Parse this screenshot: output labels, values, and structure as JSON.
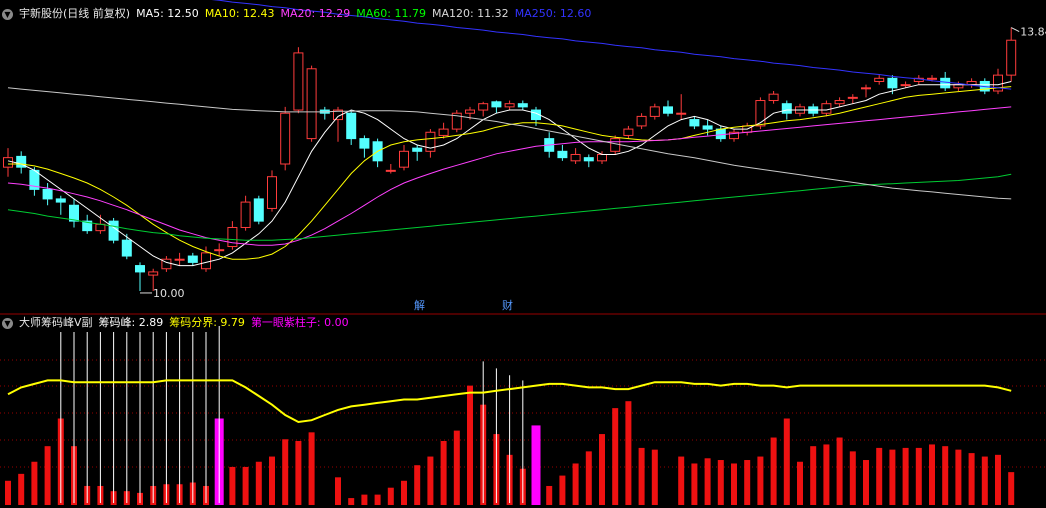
{
  "main_legend": {
    "title": "宇新股份(日线 前复权)",
    "ma5": "MA5: 12.50",
    "ma10": "MA10: 12.43",
    "ma20": "MA20: 12.29",
    "ma60": "MA60: 11.79",
    "ma120": "MA120: 11.32",
    "ma250": "MA250: 12.60"
  },
  "sub_legend": {
    "title": "大师筹码峰V副",
    "peak": "筹码峰: 2.89",
    "boundary": "筹码分界: 9.79",
    "first_purple": "第一眼紫柱子: 0.00"
  },
  "markers": {
    "jie": "解",
    "cai": "财"
  },
  "colors": {
    "background": "#000000",
    "up": "#ff3c3c",
    "down": "#54ffff",
    "ma5": "#ffffff",
    "ma10": "#ffff00",
    "ma20": "#ff40ff",
    "ma60": "#00cc33",
    "ma120": "#c8c8c8",
    "ma250": "#3333ff",
    "bar_red": "#ee1111",
    "bar_magenta": "#ff00ff",
    "bar_white": "#ffffff",
    "boundary_line": "#ffff00",
    "grid": "#990000"
  },
  "chart_data": [
    {
      "type": "candlestick",
      "title": "宇新股份(日线 前复权)",
      "y_range": [
        9.7,
        14.3
      ],
      "annotations": {
        "high": "13.84",
        "low": "10.00"
      },
      "candles": [
        [
          11.95,
          12.1,
          11.8,
          12.25
        ],
        [
          12.12,
          11.95,
          11.85,
          12.2
        ],
        [
          11.9,
          11.6,
          11.5,
          11.95
        ],
        [
          11.6,
          11.45,
          11.35,
          11.7
        ],
        [
          11.45,
          11.4,
          11.2,
          11.5
        ],
        [
          11.35,
          11.1,
          11.0,
          11.45
        ],
        [
          11.1,
          10.95,
          10.9,
          11.2
        ],
        [
          10.95,
          11.05,
          10.9,
          11.2
        ],
        [
          11.1,
          10.8,
          10.75,
          11.15
        ],
        [
          10.8,
          10.55,
          10.5,
          10.9
        ],
        [
          10.4,
          10.3,
          10.0,
          10.45
        ],
        [
          10.25,
          10.3,
          10.0,
          10.35
        ],
        [
          10.35,
          10.5,
          10.3,
          10.55
        ],
        [
          10.5,
          10.5,
          10.4,
          10.6
        ],
        [
          10.55,
          10.45,
          10.4,
          10.6
        ],
        [
          10.35,
          10.6,
          10.3,
          10.7
        ],
        [
          10.65,
          10.65,
          10.55,
          10.75
        ],
        [
          10.7,
          11.0,
          10.65,
          11.1
        ],
        [
          11.0,
          11.4,
          10.95,
          11.5
        ],
        [
          11.45,
          11.1,
          11.05,
          11.5
        ],
        [
          11.3,
          11.8,
          11.25,
          11.9
        ],
        [
          12.0,
          12.8,
          11.9,
          12.9
        ],
        [
          12.85,
          13.75,
          12.8,
          13.84
        ],
        [
          12.4,
          13.5,
          12.35,
          13.55
        ],
        [
          12.85,
          12.8,
          12.7,
          12.9
        ],
        [
          12.7,
          12.85,
          12.35,
          12.9
        ],
        [
          12.8,
          12.4,
          12.3,
          12.85
        ],
        [
          12.4,
          12.25,
          12.1,
          12.45
        ],
        [
          12.35,
          12.05,
          11.95,
          12.4
        ],
        [
          11.9,
          11.9,
          11.85,
          12.0
        ],
        [
          11.95,
          12.2,
          11.9,
          12.3
        ],
        [
          12.25,
          12.2,
          12.05,
          12.3
        ],
        [
          12.2,
          12.5,
          12.1,
          12.55
        ],
        [
          12.45,
          12.55,
          12.4,
          12.65
        ],
        [
          12.55,
          12.8,
          12.5,
          12.85
        ],
        [
          12.8,
          12.85,
          12.7,
          12.9
        ],
        [
          12.85,
          12.95,
          12.75,
          12.98
        ],
        [
          12.98,
          12.9,
          12.8,
          13.0
        ],
        [
          12.9,
          12.95,
          12.85,
          13.0
        ],
        [
          12.95,
          12.9,
          12.85,
          13.0
        ],
        [
          12.85,
          12.7,
          12.6,
          12.9
        ],
        [
          12.4,
          12.2,
          12.1,
          12.5
        ],
        [
          12.2,
          12.1,
          12.05,
          12.3
        ],
        [
          12.05,
          12.15,
          12.0,
          12.25
        ],
        [
          12.1,
          12.05,
          11.95,
          12.15
        ],
        [
          12.05,
          12.15,
          12.0,
          12.2
        ],
        [
          12.2,
          12.4,
          12.15,
          12.45
        ],
        [
          12.45,
          12.55,
          12.4,
          12.6
        ],
        [
          12.6,
          12.75,
          12.55,
          12.8
        ],
        [
          12.75,
          12.9,
          12.7,
          12.95
        ],
        [
          12.9,
          12.8,
          12.75,
          13.0
        ],
        [
          12.8,
          12.8,
          12.7,
          13.1
        ],
        [
          12.7,
          12.6,
          12.55,
          12.75
        ],
        [
          12.6,
          12.55,
          12.45,
          12.7
        ],
        [
          12.55,
          12.4,
          12.35,
          12.6
        ],
        [
          12.4,
          12.5,
          12.35,
          12.55
        ],
        [
          12.5,
          12.6,
          12.45,
          12.65
        ],
        [
          12.6,
          13.0,
          12.55,
          13.05
        ],
        [
          13.0,
          13.1,
          12.95,
          13.15
        ],
        [
          12.95,
          12.8,
          12.7,
          13.0
        ],
        [
          12.8,
          12.9,
          12.75,
          12.95
        ],
        [
          12.9,
          12.8,
          12.75,
          12.95
        ],
        [
          12.8,
          12.95,
          12.75,
          13.0
        ],
        [
          12.95,
          13.0,
          12.9,
          13.05
        ],
        [
          13.05,
          13.05,
          12.95,
          13.1
        ],
        [
          13.2,
          13.2,
          13.05,
          13.25
        ],
        [
          13.3,
          13.35,
          13.25,
          13.4
        ],
        [
          13.35,
          13.2,
          13.1,
          13.4
        ],
        [
          13.25,
          13.25,
          13.2,
          13.3
        ],
        [
          13.3,
          13.35,
          13.25,
          13.4
        ],
        [
          13.35,
          13.35,
          13.3,
          13.4
        ],
        [
          13.35,
          13.2,
          13.15,
          13.45
        ],
        [
          13.2,
          13.25,
          13.15,
          13.3
        ],
        [
          13.25,
          13.3,
          13.2,
          13.35
        ],
        [
          13.3,
          13.15,
          13.1,
          13.35
        ],
        [
          13.15,
          13.4,
          13.1,
          13.5
        ],
        [
          13.4,
          13.95,
          13.3,
          14.15
        ]
      ],
      "ma": {
        "MA5": [
          12.05,
          12.0,
          11.9,
          11.75,
          11.6,
          11.45,
          11.3,
          11.15,
          11.0,
          10.85,
          10.7,
          10.55,
          10.45,
          10.4,
          10.4,
          10.45,
          10.5,
          10.6,
          10.75,
          10.9,
          11.1,
          11.4,
          11.8,
          12.2,
          12.5,
          12.75,
          12.85,
          12.8,
          12.7,
          12.55,
          12.4,
          12.3,
          12.25,
          12.3,
          12.4,
          12.55,
          12.7,
          12.8,
          12.85,
          12.85,
          12.8,
          12.7,
          12.55,
          12.4,
          12.25,
          12.15,
          12.15,
          12.2,
          12.3,
          12.45,
          12.6,
          12.7,
          12.75,
          12.7,
          12.6,
          12.55,
          12.55,
          12.65,
          12.8,
          12.85,
          12.85,
          12.85,
          12.85,
          12.9,
          12.95,
          13.0,
          13.1,
          13.15,
          13.2,
          13.25,
          13.25,
          13.25,
          13.25,
          13.25,
          13.25,
          13.25,
          13.3
        ],
        "MA10": [
          12.0,
          12.0,
          11.97,
          11.92,
          11.85,
          11.78,
          11.7,
          11.6,
          11.48,
          11.35,
          11.2,
          11.05,
          10.92,
          10.8,
          10.7,
          10.62,
          10.55,
          10.5,
          10.5,
          10.52,
          10.58,
          10.7,
          10.88,
          11.1,
          11.35,
          11.6,
          11.85,
          12.05,
          12.2,
          12.3,
          12.35,
          12.38,
          12.4,
          12.42,
          12.45,
          12.48,
          12.52,
          12.58,
          12.62,
          12.65,
          12.65,
          12.63,
          12.6,
          12.55,
          12.5,
          12.45,
          12.42,
          12.4,
          12.38,
          12.37,
          12.38,
          12.4,
          12.45,
          12.5,
          12.55,
          12.58,
          12.6,
          12.62,
          12.65,
          12.68,
          12.7,
          12.73,
          12.76,
          12.8,
          12.85,
          12.9,
          12.95,
          13.0,
          13.05,
          13.08,
          13.1,
          13.12,
          13.14,
          13.16,
          13.18,
          13.2,
          13.22
        ],
        "MA20": [
          11.7,
          11.68,
          11.65,
          11.62,
          11.58,
          11.53,
          11.48,
          11.42,
          11.35,
          11.28,
          11.2,
          11.12,
          11.04,
          10.96,
          10.9,
          10.84,
          10.8,
          10.76,
          10.74,
          10.72,
          10.72,
          10.74,
          10.8,
          10.88,
          10.98,
          11.1,
          11.22,
          11.35,
          11.48,
          11.6,
          11.7,
          11.78,
          11.85,
          11.92,
          11.98,
          12.04,
          12.1,
          12.16,
          12.2,
          12.24,
          12.28,
          12.3,
          12.32,
          12.34,
          12.35,
          12.35,
          12.35,
          12.35,
          12.36,
          12.37,
          12.38,
          12.4,
          12.42,
          12.44,
          12.46,
          12.48,
          12.5,
          12.52,
          12.54,
          12.56,
          12.58,
          12.6,
          12.62,
          12.64,
          12.66,
          12.68,
          12.7,
          12.72,
          12.74,
          12.76,
          12.78,
          12.8,
          12.82,
          12.84,
          12.86,
          12.88,
          12.9
        ],
        "MA60": [
          11.28,
          11.25,
          11.22,
          11.18,
          11.15,
          11.12,
          11.08,
          11.05,
          11.02,
          10.98,
          10.95,
          10.92,
          10.9,
          10.87,
          10.85,
          10.83,
          10.82,
          10.81,
          10.8,
          10.8,
          10.8,
          10.81,
          10.82,
          10.84,
          10.86,
          10.88,
          10.9,
          10.92,
          10.94,
          10.96,
          10.98,
          11.0,
          11.02,
          11.04,
          11.06,
          11.08,
          11.1,
          11.12,
          11.14,
          11.16,
          11.18,
          11.2,
          11.22,
          11.24,
          11.26,
          11.28,
          11.3,
          11.32,
          11.34,
          11.36,
          11.38,
          11.4,
          11.42,
          11.44,
          11.46,
          11.48,
          11.5,
          11.52,
          11.54,
          11.56,
          11.58,
          11.6,
          11.62,
          11.64,
          11.66,
          11.67,
          11.68,
          11.69,
          11.7,
          11.71,
          11.72,
          11.73,
          11.74,
          11.76,
          11.78,
          11.8,
          11.84
        ],
        "MA120": [
          13.2,
          13.18,
          13.16,
          13.14,
          13.12,
          13.1,
          13.08,
          13.06,
          13.04,
          13.02,
          13.0,
          12.98,
          12.96,
          12.94,
          12.92,
          12.9,
          12.88,
          12.86,
          12.85,
          12.84,
          12.83,
          12.82,
          12.82,
          12.82,
          12.82,
          12.83,
          12.83,
          12.84,
          12.84,
          12.84,
          12.83,
          12.82,
          12.8,
          12.78,
          12.76,
          12.73,
          12.7,
          12.67,
          12.63,
          12.6,
          12.56,
          12.52,
          12.48,
          12.44,
          12.4,
          12.36,
          12.32,
          12.28,
          12.24,
          12.2,
          12.16,
          12.13,
          12.1,
          12.06,
          12.02,
          11.98,
          11.95,
          11.92,
          11.89,
          11.86,
          11.83,
          11.8,
          11.77,
          11.74,
          11.71,
          11.68,
          11.65,
          11.62,
          11.6,
          11.58,
          11.56,
          11.54,
          11.52,
          11.5,
          11.48,
          11.46,
          11.45
        ],
        "MA250": [
          14.95,
          14.93,
          14.9,
          14.88,
          14.86,
          14.83,
          14.81,
          14.79,
          14.76,
          14.74,
          14.72,
          14.69,
          14.67,
          14.65,
          14.62,
          14.6,
          14.58,
          14.55,
          14.53,
          14.51,
          14.48,
          14.46,
          14.43,
          14.41,
          14.39,
          14.36,
          14.34,
          14.32,
          14.29,
          14.27,
          14.25,
          14.22,
          14.2,
          14.18,
          14.15,
          14.13,
          14.11,
          14.08,
          14.06,
          14.04,
          14.01,
          13.99,
          13.97,
          13.94,
          13.92,
          13.9,
          13.87,
          13.85,
          13.83,
          13.8,
          13.78,
          13.76,
          13.73,
          13.71,
          13.69,
          13.66,
          13.64,
          13.62,
          13.59,
          13.57,
          13.55,
          13.52,
          13.5,
          13.48,
          13.45,
          13.43,
          13.41,
          13.38,
          13.36,
          13.34,
          13.31,
          13.29,
          13.27,
          13.24,
          13.22,
          13.2,
          13.18
        ]
      }
    },
    {
      "type": "bar",
      "title": "大师筹码峰V副",
      "y_range": [
        0,
        10
      ],
      "red_bars": [
        1.4,
        1.8,
        2.5,
        3.4,
        5.0,
        3.4,
        1.1,
        1.1,
        0.8,
        0.8,
        0.7,
        1.1,
        1.2,
        1.2,
        1.3,
        1.1,
        1.4,
        2.2,
        2.2,
        2.5,
        2.8,
        3.8,
        3.7,
        4.2,
        0,
        1.6,
        0.4,
        0.6,
        0.6,
        1.0,
        1.4,
        2.3,
        2.8,
        3.7,
        4.3,
        6.9,
        5.8,
        4.1,
        2.9,
        2.1,
        1.5,
        1.1,
        1.7,
        2.4,
        3.1,
        4.1,
        5.6,
        6.0,
        3.3,
        3.2,
        0,
        2.8,
        2.4,
        2.7,
        2.6,
        2.4,
        2.6,
        2.8,
        3.9,
        5.0,
        2.5,
        3.4,
        3.5,
        3.9,
        3.1,
        2.6,
        3.3,
        3.2,
        3.3,
        3.3,
        3.5,
        3.4,
        3.2,
        3.0,
        2.8,
        2.9,
        1.9
      ],
      "magenta_bars": {
        "indices": [
          16,
          40
        ],
        "values": [
          5.0,
          4.6
        ]
      },
      "white_lines": {
        "indices": [
          4,
          5,
          6,
          7,
          8,
          9,
          10,
          11,
          12,
          13,
          14,
          15,
          16,
          36,
          37,
          38,
          39
        ],
        "values": [
          10,
          10,
          10,
          10,
          10,
          10,
          10,
          10,
          10,
          10,
          10,
          10,
          17,
          8.3,
          7.9,
          7.5,
          7.2
        ]
      },
      "boundary": [
        6.4,
        6.8,
        7.0,
        7.2,
        7.2,
        7.1,
        7.1,
        7.1,
        7.1,
        7.1,
        7.1,
        7.1,
        7.2,
        7.2,
        7.2,
        7.2,
        7.2,
        7.2,
        6.8,
        6.3,
        5.8,
        5.2,
        4.8,
        4.9,
        5.2,
        5.5,
        5.7,
        5.8,
        5.9,
        6.0,
        6.1,
        6.1,
        6.2,
        6.3,
        6.4,
        6.5,
        6.5,
        6.6,
        6.7,
        6.8,
        6.9,
        7.0,
        7.0,
        6.9,
        6.8,
        6.8,
        6.7,
        6.7,
        6.9,
        7.1,
        7.1,
        7.1,
        7.0,
        7.0,
        6.9,
        7.0,
        7.0,
        6.9,
        6.9,
        6.8,
        6.9,
        6.9,
        6.9,
        6.9,
        6.9,
        6.9,
        6.9,
        6.9,
        6.9,
        6.9,
        6.9,
        6.9,
        6.9,
        6.9,
        6.9,
        6.8,
        6.6
      ]
    }
  ]
}
